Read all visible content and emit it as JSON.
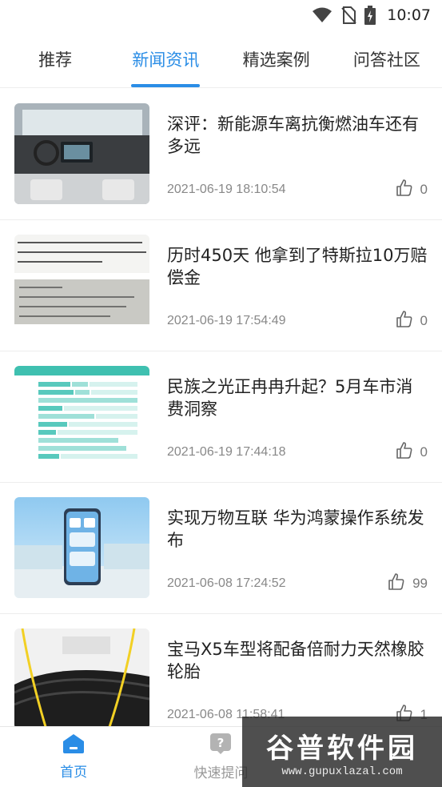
{
  "status_bar": {
    "time": "10:07",
    "icons": [
      "wifi-icon",
      "no-sim-icon",
      "battery-charging-icon"
    ]
  },
  "tabs": [
    {
      "label": "推荐",
      "active": false
    },
    {
      "label": "新闻资讯",
      "active": true
    },
    {
      "label": "精选案例",
      "active": false
    },
    {
      "label": "问答社区",
      "active": false
    }
  ],
  "news": [
    {
      "title": "深评：新能源车离抗衡燃油车还有多远",
      "date": "2021-06-19 18:10:54",
      "likes": "0",
      "thumb": "car-interior-photo"
    },
    {
      "title": "历时450天 他拿到了特斯拉10万赔偿金",
      "date": "2021-06-19 17:54:49",
      "likes": "0",
      "thumb": "document-photo"
    },
    {
      "title": "民族之光正冉冉升起？5月车市消费洞察",
      "date": "2021-06-19 17:44:18",
      "likes": "0",
      "thumb": "bar-chart-image"
    },
    {
      "title": "实现万物互联 华为鸿蒙操作系统发布",
      "date": "2021-06-08 17:24:52",
      "likes": "99",
      "thumb": "phone-launch-photo"
    },
    {
      "title": "宝马X5车型将配备倍耐力天然橡胶轮胎",
      "date": "2021-06-08 11:58:41",
      "likes": "1",
      "thumb": "tire-photo"
    }
  ],
  "bottom_nav": [
    {
      "label": "首页",
      "icon": "home-icon",
      "active": true
    },
    {
      "label": "快速提问",
      "icon": "question-icon",
      "active": false
    }
  ],
  "watermark": {
    "text": "谷普软件园",
    "url": "www.gupuxlazal.com"
  },
  "colors": {
    "accent": "#2a8de6",
    "text_primary": "#222222",
    "text_secondary": "#888888",
    "divider": "#ededed"
  }
}
